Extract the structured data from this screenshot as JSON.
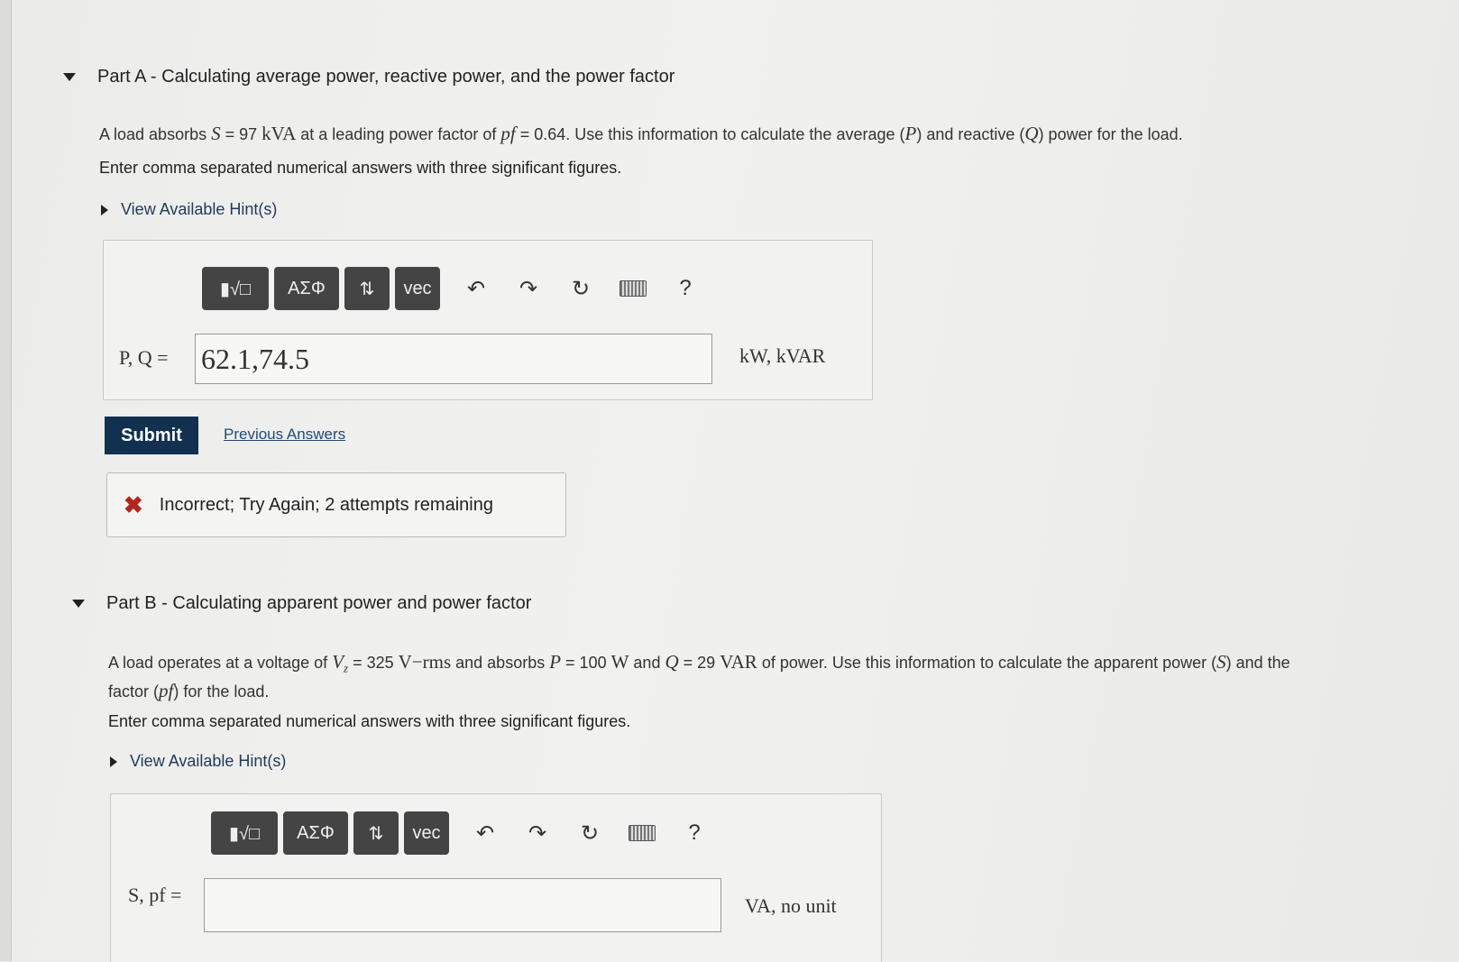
{
  "part_a": {
    "header": "Part A - Calculating average power, reactive power, and the power factor",
    "problem": {
      "t1": "A load absorbs ",
      "S": "S",
      "t2": " = 97 ",
      "kVA": "kVA",
      "t3": " at a leading power factor of ",
      "pf": "pf",
      "t4": " = 0.64. Use this information to calculate the average (",
      "P": "P",
      "t5": ") and reactive (",
      "Q": "Q",
      "t6": ") power for the load."
    },
    "instruction": "Enter comma separated numerical answers with three significant figures.",
    "hint": "View Available Hint(s)",
    "toolbar": {
      "templates": "▮√□",
      "greek": "AΣΦ",
      "arrows": "⇅",
      "vec": "vec",
      "undo": "↶",
      "redo": "↷",
      "reset": "↻",
      "help": "?"
    },
    "input_label": "P, Q =",
    "input_value": "62.1,74.5",
    "units": "kW, kVAR",
    "submit": "Submit",
    "previous_answers": "Previous Answers",
    "feedback": "Incorrect; Try Again; 2 attempts remaining",
    "feedback_icon": "✖"
  },
  "part_b": {
    "header": "Part B - Calculating apparent power and power factor",
    "problem": {
      "t1": "A load operates at a voltage of ",
      "V": "V",
      "Vsub": "z",
      "t2": " = 325 ",
      "Vrms": "V−rms",
      "t3": " and absorbs ",
      "P": "P",
      "t4": " = 100 ",
      "W": "W",
      "t5": " and ",
      "Q": "Q",
      "t6": " = 29 ",
      "VAR": "VAR",
      "t7": " of power. Use this information to calculate the apparent power (",
      "S": "S",
      "t8": ") and the",
      "t9": "factor (",
      "pf": "pf",
      "t10": ") for the load."
    },
    "instruction": "Enter comma separated numerical answers with three significant figures.",
    "hint": "View Available Hint(s)",
    "toolbar": {
      "templates": "▮√□",
      "greek": "AΣΦ",
      "arrows": "⇅",
      "vec": "vec",
      "undo": "↶",
      "redo": "↷",
      "reset": "↻",
      "help": "?"
    },
    "input_label": "S, pf =",
    "input_value": "",
    "units": "VA, no unit"
  }
}
